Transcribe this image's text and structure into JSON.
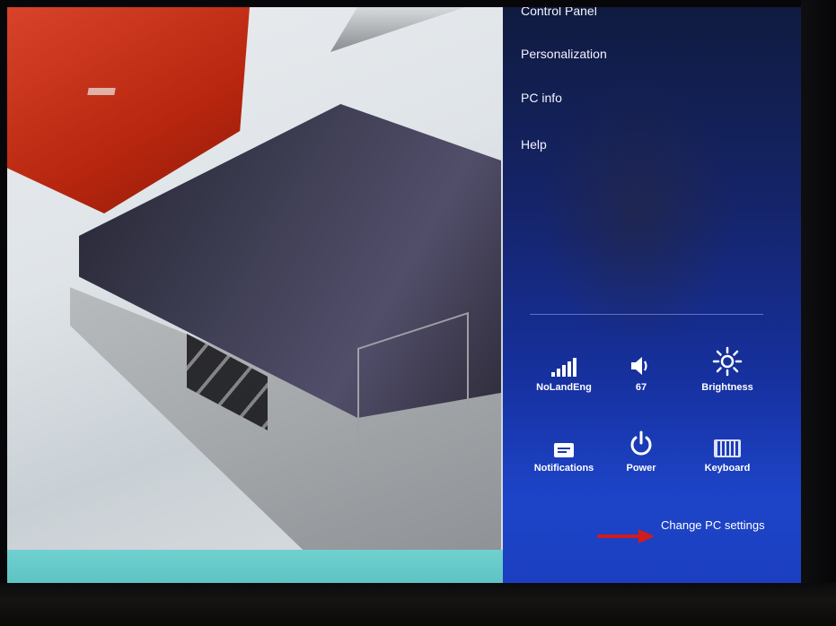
{
  "settings_pane": {
    "items": [
      {
        "label": "Control Panel"
      },
      {
        "label": "Personalization"
      },
      {
        "label": "PC info"
      },
      {
        "label": "Help"
      }
    ],
    "tiles": [
      {
        "label": "NoLandEng",
        "icon": "wifi-signal-icon"
      },
      {
        "label": "67",
        "icon": "volume-icon"
      },
      {
        "label": "Brightness",
        "icon": "brightness-icon"
      },
      {
        "label": "Notifications",
        "icon": "notifications-icon"
      },
      {
        "label": "Power",
        "icon": "power-icon"
      },
      {
        "label": "Keyboard",
        "icon": "keyboard-icon"
      }
    ],
    "change_pc_settings": "Change PC settings"
  },
  "annotation": {
    "icon": "red-arrow-icon",
    "color": "#d21b1b"
  },
  "colors": {
    "pane_top": "#101b3f",
    "pane_bottom": "#1d44c8",
    "taskbar_strip": "#6fd1d0",
    "laptop_red": "#c8321a"
  }
}
